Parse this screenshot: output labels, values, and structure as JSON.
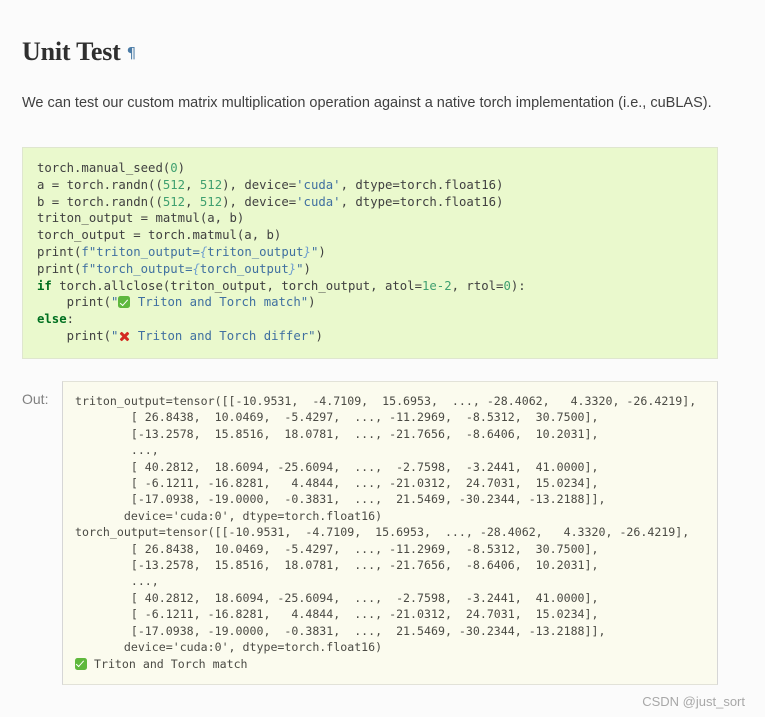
{
  "heading": {
    "title": "Unit Test",
    "anchor_glyph": "¶"
  },
  "intro": {
    "text": "We can test our custom matrix multiplication operation against a native torch implementation (i.e., cuBLAS)."
  },
  "code_block": {
    "language": "python",
    "lines": [
      "torch.manual_seed(0)",
      "a = torch.randn((512, 512), device='cuda', dtype=torch.float16)",
      "b = torch.randn((512, 512), device='cuda', dtype=torch.float16)",
      "triton_output = matmul(a, b)",
      "torch_output = torch.matmul(a, b)",
      "print(f\"triton_output={triton_output}\")",
      "print(f\"torch_output={torch_output}\")",
      "if torch.allclose(triton_output, torch_output, atol=1e-2, rtol=0):",
      "    print(\"✅ Triton and Torch match\")",
      "else:",
      "    print(\"❌ Triton and Torch differ\")"
    ]
  },
  "output": {
    "label": "Out:",
    "lines": [
      "triton_output=tensor([[-10.9531,  -4.7109,  15.6953,  ..., -28.4062,   4.3320, -26.4219],",
      "        [ 26.8438,  10.0469,  -5.4297,  ..., -11.2969,  -8.5312,  30.7500],",
      "        [-13.2578,  15.8516,  18.0781,  ..., -21.7656,  -8.6406,  10.2031],",
      "        ...,",
      "        [ 40.2812,  18.6094, -25.6094,  ...,  -2.7598,  -3.2441,  41.0000],",
      "        [ -6.1211, -16.8281,   4.4844,  ..., -21.0312,  24.7031,  15.0234],",
      "        [-17.0938, -19.0000,  -0.3831,  ...,  21.5469, -30.2344, -13.2188]],",
      "       device='cuda:0', dtype=torch.float16)",
      "torch_output=tensor([[-10.9531,  -4.7109,  15.6953,  ..., -28.4062,   4.3320, -26.4219],",
      "        [ 26.8438,  10.0469,  -5.4297,  ..., -11.2969,  -8.5312,  30.7500],",
      "        [-13.2578,  15.8516,  18.0781,  ..., -21.7656,  -8.6406,  10.2031],",
      "        ...,",
      "        [ 40.2812,  18.6094, -25.6094,  ...,  -2.7598,  -3.2441,  41.0000],",
      "        [ -6.1211, -16.8281,   4.4844,  ..., -21.0312,  24.7031,  15.0234],",
      "        [-17.0938, -19.0000,  -0.3831,  ...,  21.5469, -30.2344, -13.2188]],",
      "       device='cuda:0', dtype=torch.float16)",
      "✅ Triton and Torch match"
    ]
  },
  "watermark": {
    "text": "CSDN @just_sort"
  },
  "colors": {
    "page_background": "#fbfbfb",
    "code_background": "#eaf9cd",
    "code_border": "#dfe6cf",
    "output_background": "#fbfbee",
    "output_border": "#d6d6d6",
    "keyword": "#007020",
    "string": "#4070a0",
    "number": "#40a070",
    "text": "#404040",
    "anchor_link": "#4a7ba6",
    "watermark": "#a8a8a8",
    "check_green": "#5fb83d",
    "cross_red": "#d42b21"
  }
}
